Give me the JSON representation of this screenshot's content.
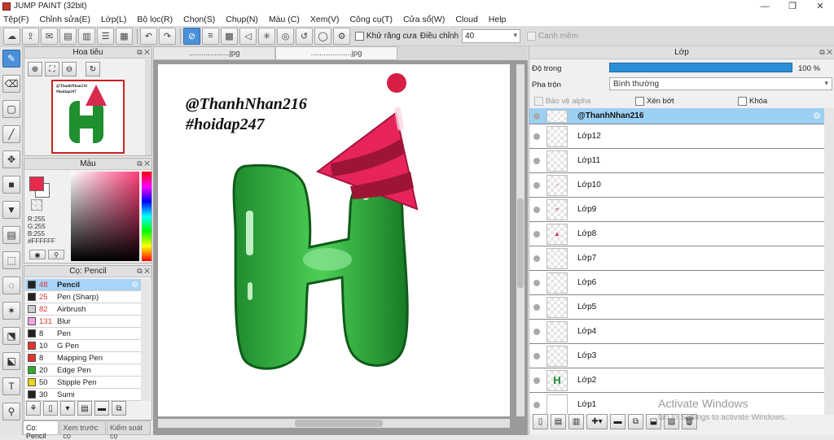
{
  "window": {
    "title": "JUMP PAINT (32bit)",
    "minimize": "—",
    "maximize": "❐",
    "close": "✕"
  },
  "menu": [
    "Tệp(F)",
    "Chỉnh sửa(E)",
    "Lớp(L)",
    "Bộ lọc(R)",
    "Chọn(S)",
    "Chụp(N)",
    "Màu (C)",
    "Xem(V)",
    "Công cụ(T)",
    "Cửa sổ(W)",
    "Cloud",
    "Help"
  ],
  "toolbar": {
    "antialias_label": "Khử răng cưa",
    "adjust_label": "Điều chỉnh",
    "adjust_value": "40",
    "snap_label": "Canh mềm"
  },
  "navigator": {
    "title": "Hoa tiêu",
    "thumb_text_1": "@ThanhNhan216",
    "thumb_text_2": "#hoidap247"
  },
  "color": {
    "title": "Màu",
    "r": "R:255",
    "g": "G:255",
    "b": "B:255",
    "hex": "#FFFFFF",
    "primary": "#e52a4b",
    "secondary": "#ffffff"
  },
  "brush": {
    "title": "Cọ: Pencil",
    "items": [
      {
        "size": "48",
        "name": "Pencil",
        "color": "#222222"
      },
      {
        "size": "25",
        "name": "Pen (Sharp)",
        "color": "#222222"
      },
      {
        "size": "82",
        "name": "Airbrush",
        "color": "#cccccc"
      },
      {
        "size": "131",
        "name": "Blur",
        "color": "#f3a6e0"
      },
      {
        "size": "8",
        "name": "Pen",
        "color": "#222222"
      },
      {
        "size": "10",
        "name": "G Pen",
        "color": "#e0342f"
      },
      {
        "size": "8",
        "name": "Mapping Pen",
        "color": "#e0342f"
      },
      {
        "size": "20",
        "name": "Edge Pen",
        "color": "#2faa2f"
      },
      {
        "size": "50",
        "name": "Stipple Pen",
        "color": "#e6d51f"
      },
      {
        "size": "30",
        "name": "Sumi",
        "color": "#222222"
      }
    ]
  },
  "bottom_tabs": [
    "Cọ: Pencil",
    "Xem trước cọ",
    "Kiểm soát cọ"
  ],
  "doc_tabs": [
    "...................jpg",
    "...................jpg"
  ],
  "canvas": {
    "text_1": "@ThanhNhan216",
    "text_2": "#hoidap247"
  },
  "layer_panel": {
    "title": "Lớp",
    "opacity_label": "Độ trong",
    "opacity_value": "100 %",
    "opacity": 1.0,
    "blend_label": "Pha trộn",
    "blend_value": "Bình thường",
    "protect_alpha": "Bảo vệ alpha",
    "clip": "Xén bớt",
    "lock": "Khóa",
    "layers": [
      "@ThanhNhan216",
      "Lớp12",
      "Lớp11",
      "Lớp10",
      "Lớp9",
      "Lớp8",
      "Lớp7",
      "Lớp6",
      "Lớp5",
      "Lớp4",
      "Lớp3",
      "Lớp2",
      "Lớp1"
    ]
  },
  "watermark": {
    "line1": "Activate Windows",
    "line2": "Go to Settings to activate Windows."
  }
}
